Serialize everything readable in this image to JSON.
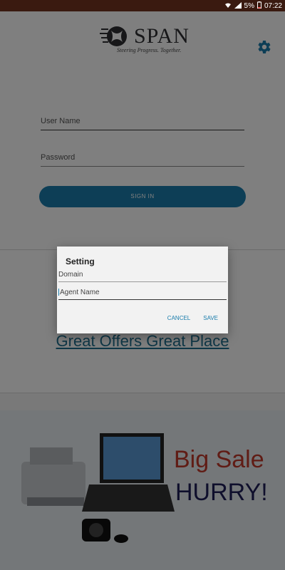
{
  "status_bar": {
    "battery": "5%",
    "time": "07:22"
  },
  "app": {
    "logo_text": "SPAN",
    "logo_tagline": "Steering Progress. Together.",
    "settings_icon": "gear-icon"
  },
  "login": {
    "username_placeholder": "User Name",
    "password_placeholder": "Password",
    "signin_label": "SIGN IN"
  },
  "promo": {
    "offers_text": "Great Offers Great Place"
  },
  "banner": {
    "line1": "Big Sale",
    "line2": "HURRY!"
  },
  "dialog": {
    "title": "Setting",
    "domain_placeholder": "Domain",
    "agent_placeholder": "Agent Name",
    "cancel_label": "CANCEL",
    "save_label": "SAVE"
  },
  "colors": {
    "accent": "#1a7dac",
    "status_bar": "#3a1a10"
  }
}
